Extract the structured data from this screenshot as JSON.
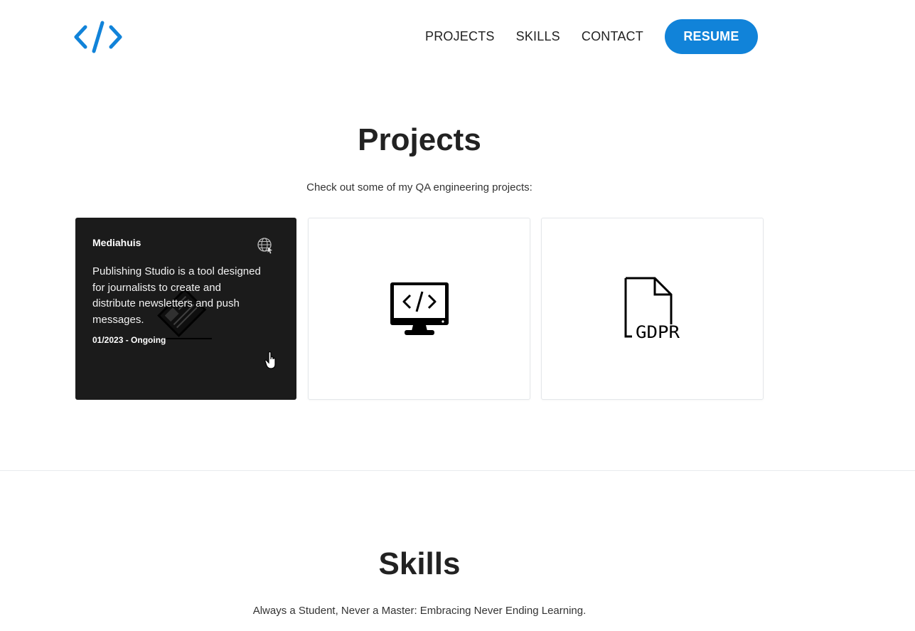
{
  "header": {
    "logo_icon": "code-brackets-icon",
    "nav": [
      {
        "label": "PROJECTS"
      },
      {
        "label": "SKILLS"
      },
      {
        "label": "CONTACT"
      }
    ],
    "resume_label": "RESUME",
    "accent_color": "#1183d9"
  },
  "projects": {
    "title": "Projects",
    "subtitle": "Check out some of my QA engineering projects:",
    "cards": [
      {
        "title": "Mediahuis",
        "description": "Publishing Studio is a tool designed for journalists to create and distribute newsletters and push messages.",
        "date": "01/2023 - Ongoing",
        "icon": "newspaper-icon",
        "link_icon": "globe-icon",
        "state": "hovered"
      },
      {
        "icon": "computer-code-icon"
      },
      {
        "icon": "gdpr-document-icon",
        "icon_text": "GDPR"
      }
    ]
  },
  "skills": {
    "title": "Skills",
    "subtitle": "Always a Student, Never a Master: Embracing Never Ending Learning."
  }
}
